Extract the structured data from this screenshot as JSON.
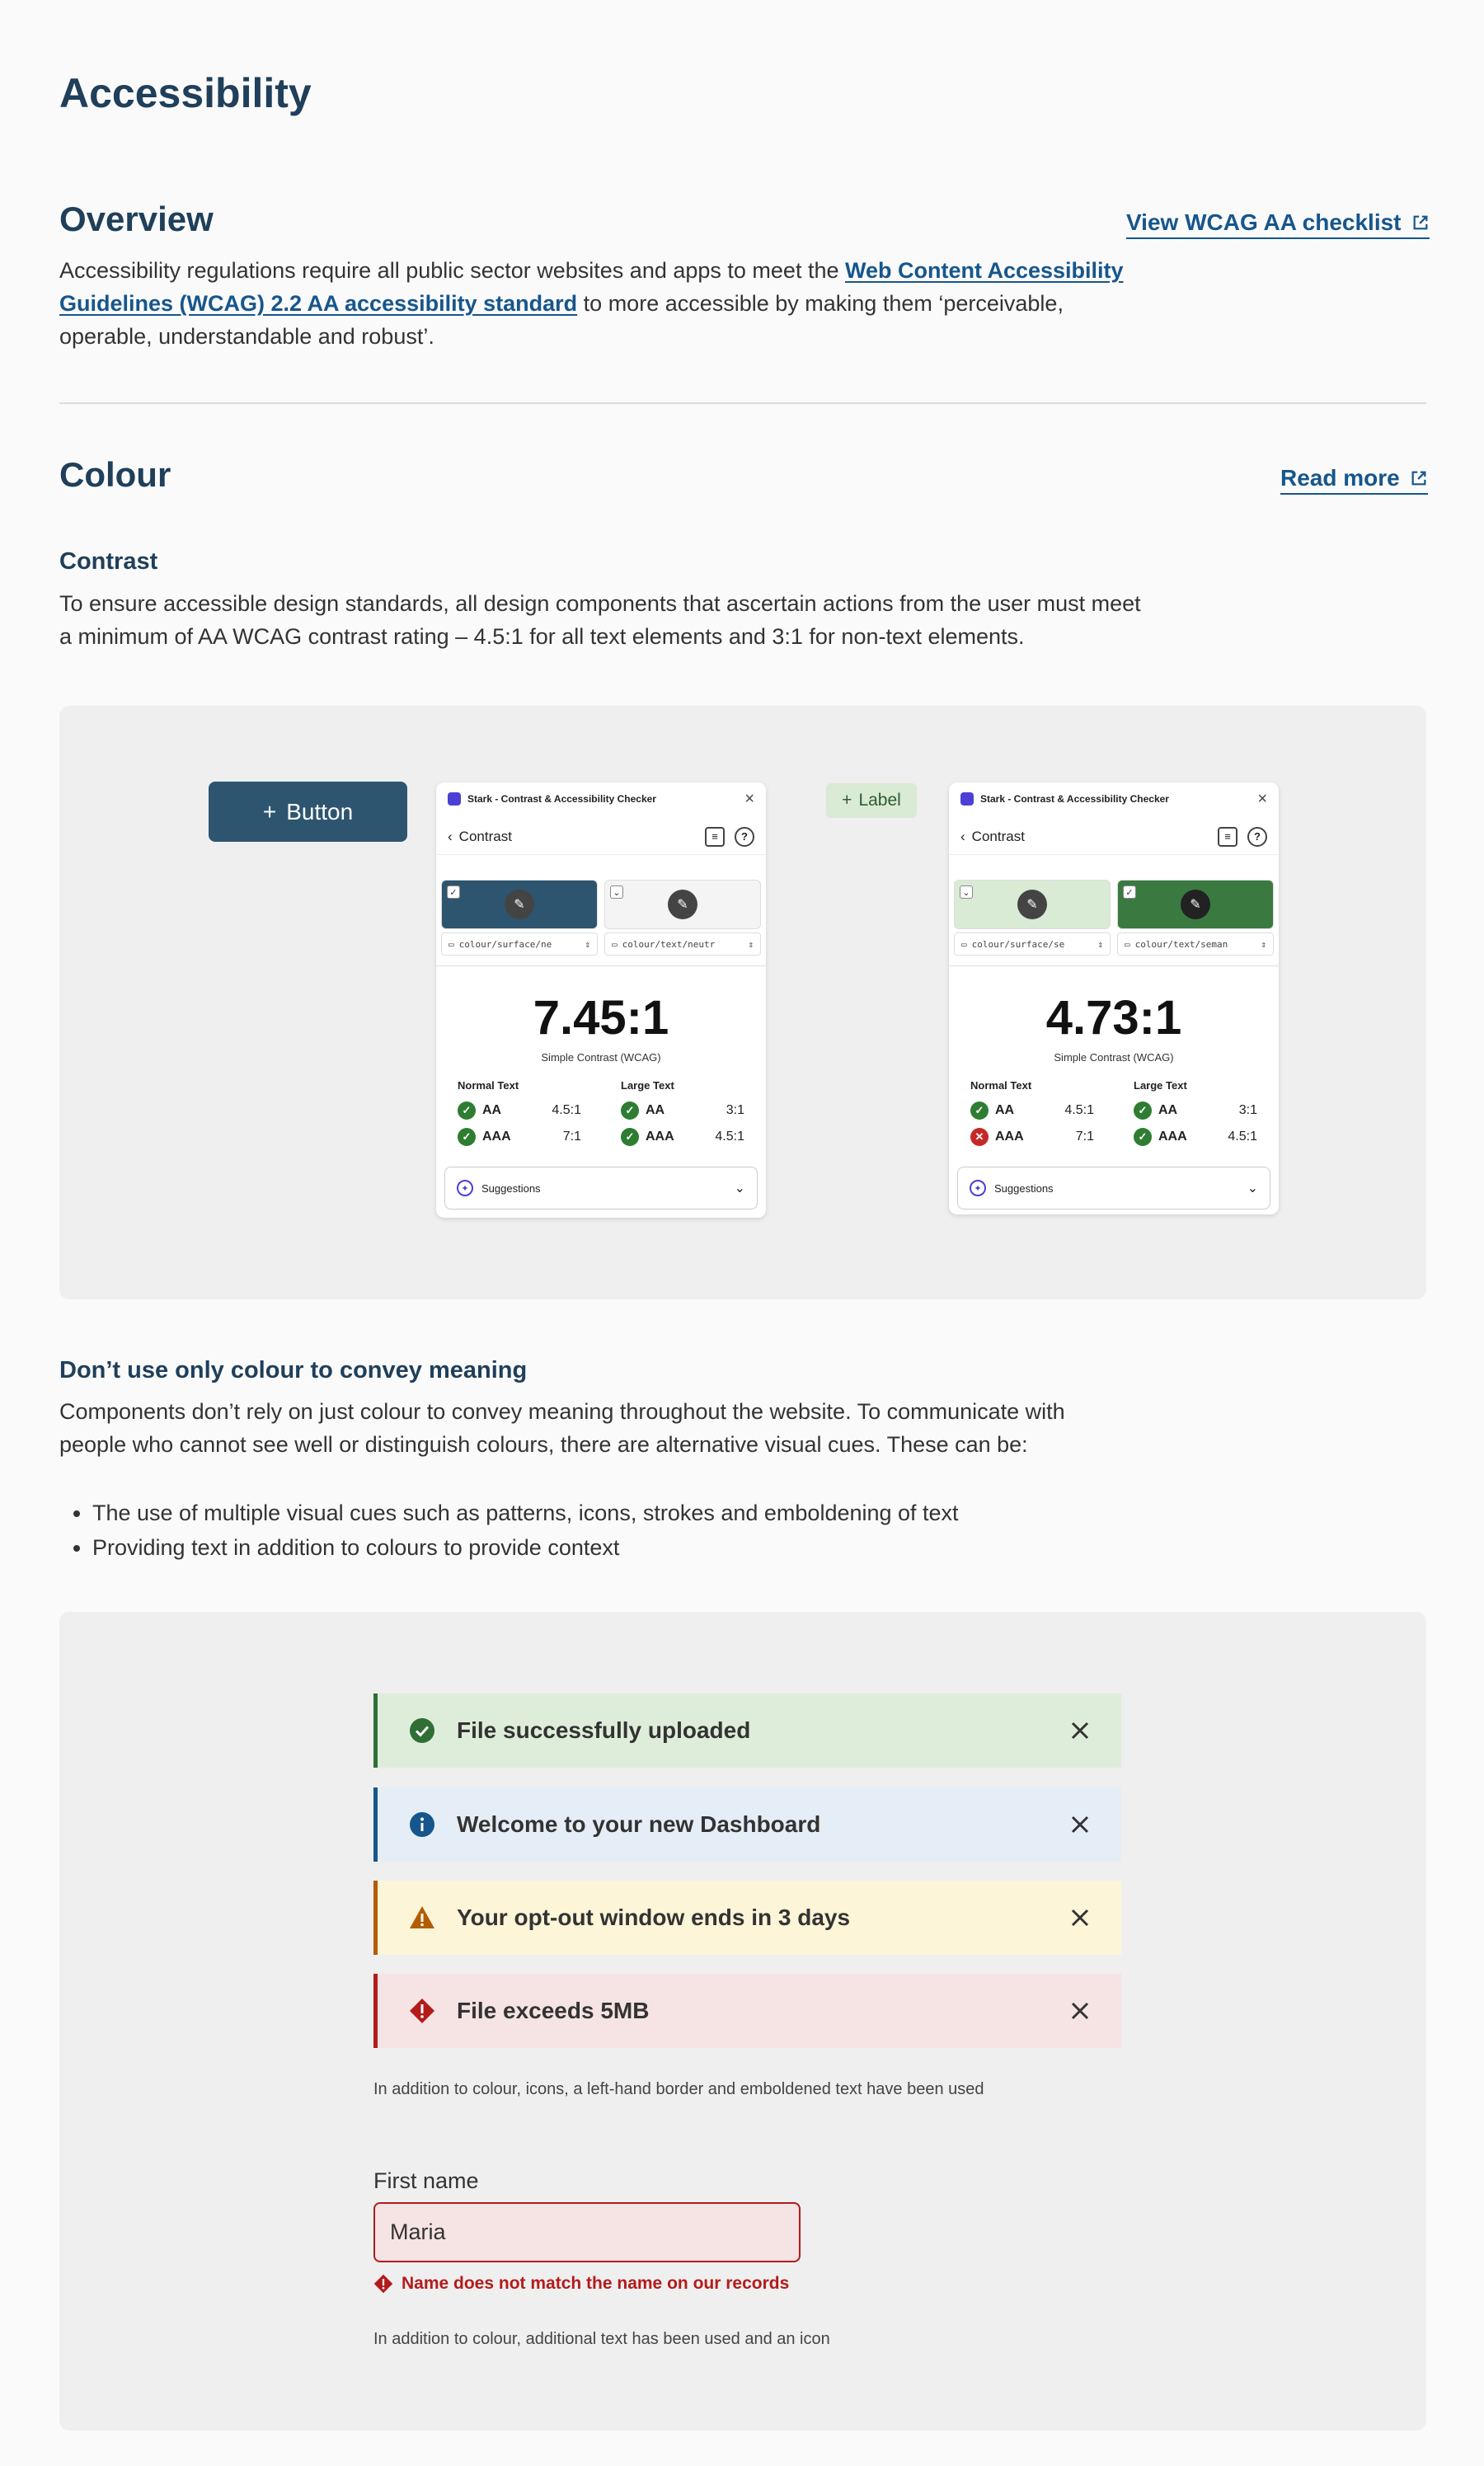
{
  "page": {
    "title": "Accessibility"
  },
  "overview": {
    "heading": "Overview",
    "link_label": "View WCAG AA checklist",
    "text_before": "Accessibility regulations require all public sector websites and apps to meet the ",
    "link_text": "Web Content Accessibility Guidelines (WCAG) 2.2 AA accessibility standard",
    "text_after": " to more accessible by making them ‘perceivable, operable, understandable and robust’."
  },
  "colour": {
    "heading": "Colour",
    "link_label": "Read more",
    "contrast": {
      "heading": "Contrast",
      "text": "To ensure accessible design standards, all design components that ascertain actions from the user must meet a minimum of AA WCAG contrast rating – 4.5:1 for all text elements and 3:1 for non-text elements."
    },
    "demo_button": {
      "label": "Button",
      "icon": "plus-icon"
    },
    "demo_label": {
      "label": "Label",
      "icon": "plus-icon"
    },
    "checkers": [
      {
        "app_title": "Stark - Contrast & Accessibility Checker",
        "nav_title": "Contrast",
        "fg_color": "#2d5570",
        "bg_color": "#f4f4f4",
        "token_1": "colour/surface/ne",
        "token_2": "colour/text/neutr",
        "ratio": "7.45:1",
        "ratio_label": "Simple Contrast (WCAG)",
        "normal_label": "Normal Text",
        "large_label": "Large Text",
        "normal": [
          {
            "level": "AA",
            "value": "4.5:1",
            "pass": true
          },
          {
            "level": "AAA",
            "value": "7:1",
            "pass": true
          }
        ],
        "large": [
          {
            "level": "AA",
            "value": "3:1",
            "pass": true
          },
          {
            "level": "AAA",
            "value": "4.5:1",
            "pass": true
          }
        ],
        "suggestions": "Suggestions"
      },
      {
        "app_title": "Stark - Contrast & Accessibility Checker",
        "nav_title": "Contrast",
        "fg_color": "#d9ead5",
        "bg_color": "#3a7a40",
        "token_1": "colour/surface/se",
        "token_2": "colour/text/seman",
        "ratio": "4.73:1",
        "ratio_label": "Simple Contrast (WCAG)",
        "normal_label": "Normal Text",
        "large_label": "Large Text",
        "normal": [
          {
            "level": "AA",
            "value": "4.5:1",
            "pass": true
          },
          {
            "level": "AAA",
            "value": "7:1",
            "pass": false
          }
        ],
        "large": [
          {
            "level": "AA",
            "value": "3:1",
            "pass": true
          },
          {
            "level": "AAA",
            "value": "4.5:1",
            "pass": true
          }
        ],
        "suggestions": "Suggestions"
      }
    ],
    "meaning": {
      "heading": "Don’t use only colour to convey meaning",
      "text": "Components don’t rely on just colour to convey meaning throughout the website. To communicate with people who cannot see well or distinguish colours, there are alternative visual cues. These can be:",
      "bullets": [
        "The use of multiple visual cues such as patterns, icons, strokes and emboldening of text",
        "Providing text in addition to colours to provide context"
      ]
    },
    "alerts": [
      {
        "type": "success",
        "text": "File successfully uploaded",
        "color": "#2f6e35"
      },
      {
        "type": "info",
        "text": "Welcome to your new Dashboard",
        "color": "#16568c"
      },
      {
        "type": "warning",
        "text": "Your opt-out window ends in 3 days",
        "color": "#b35c00"
      },
      {
        "type": "error",
        "text": "File exceeds 5MB",
        "color": "#b31b1b"
      }
    ],
    "alerts_caption": "In addition to colour, icons, a left-hand border and emboldened text have been used",
    "form": {
      "label": "First name",
      "value": "Maria",
      "error": "Name does not match the name on our records",
      "caption": "In addition to colour, additional text has been used and an icon"
    }
  }
}
